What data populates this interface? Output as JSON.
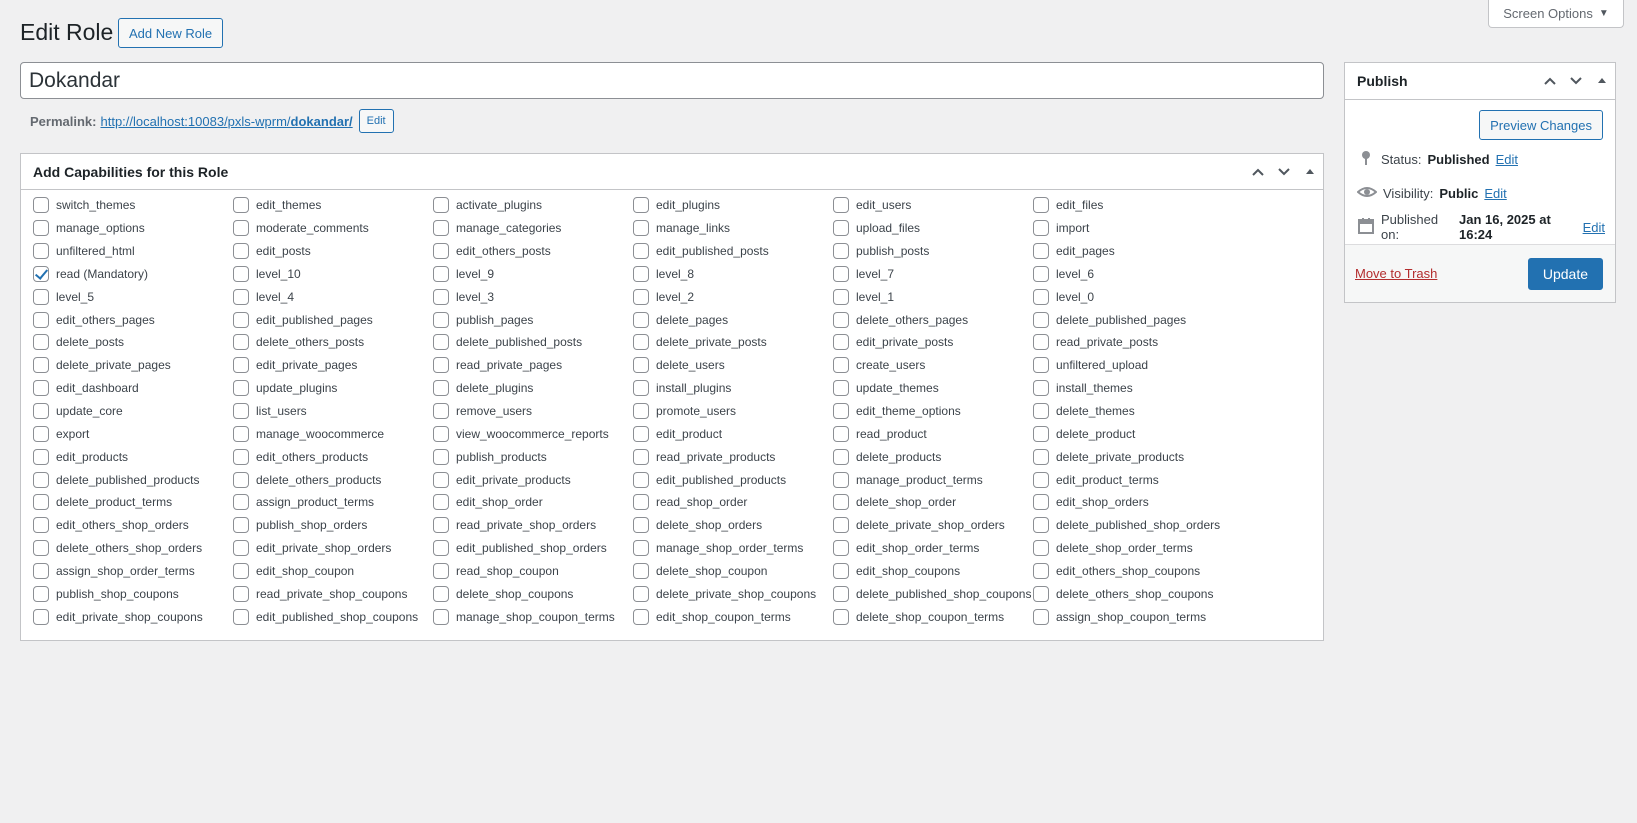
{
  "header": {
    "screen_options": "Screen Options",
    "title": "Edit Role",
    "add_new": "Add New Role"
  },
  "role_name": "Dokandar",
  "permalink": {
    "label": "Permalink:",
    "url_base": "http://localhost:10083/pxls-wprm/",
    "slug": "dokandar/",
    "edit_label": "Edit"
  },
  "capabilities": {
    "title": "Add Capabilities for this Role",
    "items": [
      {
        "label": "switch_themes",
        "checked": false
      },
      {
        "label": "edit_themes",
        "checked": false
      },
      {
        "label": "activate_plugins",
        "checked": false
      },
      {
        "label": "edit_plugins",
        "checked": false
      },
      {
        "label": "edit_users",
        "checked": false
      },
      {
        "label": "edit_files",
        "checked": false
      },
      {
        "label": "manage_options",
        "checked": false
      },
      {
        "label": "moderate_comments",
        "checked": false
      },
      {
        "label": "manage_categories",
        "checked": false
      },
      {
        "label": "manage_links",
        "checked": false
      },
      {
        "label": "upload_files",
        "checked": false
      },
      {
        "label": "import",
        "checked": false
      },
      {
        "label": "unfiltered_html",
        "checked": false
      },
      {
        "label": "edit_posts",
        "checked": false
      },
      {
        "label": "edit_others_posts",
        "checked": false
      },
      {
        "label": "edit_published_posts",
        "checked": false
      },
      {
        "label": "publish_posts",
        "checked": false
      },
      {
        "label": "edit_pages",
        "checked": false
      },
      {
        "label": "read (Mandatory)",
        "checked": true
      },
      {
        "label": "level_10",
        "checked": false
      },
      {
        "label": "level_9",
        "checked": false
      },
      {
        "label": "level_8",
        "checked": false
      },
      {
        "label": "level_7",
        "checked": false
      },
      {
        "label": "level_6",
        "checked": false
      },
      {
        "label": "level_5",
        "checked": false
      },
      {
        "label": "level_4",
        "checked": false
      },
      {
        "label": "level_3",
        "checked": false
      },
      {
        "label": "level_2",
        "checked": false
      },
      {
        "label": "level_1",
        "checked": false
      },
      {
        "label": "level_0",
        "checked": false
      },
      {
        "label": "edit_others_pages",
        "checked": false
      },
      {
        "label": "edit_published_pages",
        "checked": false
      },
      {
        "label": "publish_pages",
        "checked": false
      },
      {
        "label": "delete_pages",
        "checked": false
      },
      {
        "label": "delete_others_pages",
        "checked": false
      },
      {
        "label": "delete_published_pages",
        "checked": false
      },
      {
        "label": "delete_posts",
        "checked": false
      },
      {
        "label": "delete_others_posts",
        "checked": false
      },
      {
        "label": "delete_published_posts",
        "checked": false
      },
      {
        "label": "delete_private_posts",
        "checked": false
      },
      {
        "label": "edit_private_posts",
        "checked": false
      },
      {
        "label": "read_private_posts",
        "checked": false
      },
      {
        "label": "delete_private_pages",
        "checked": false
      },
      {
        "label": "edit_private_pages",
        "checked": false
      },
      {
        "label": "read_private_pages",
        "checked": false
      },
      {
        "label": "delete_users",
        "checked": false
      },
      {
        "label": "create_users",
        "checked": false
      },
      {
        "label": "unfiltered_upload",
        "checked": false
      },
      {
        "label": "edit_dashboard",
        "checked": false
      },
      {
        "label": "update_plugins",
        "checked": false
      },
      {
        "label": "delete_plugins",
        "checked": false
      },
      {
        "label": "install_plugins",
        "checked": false
      },
      {
        "label": "update_themes",
        "checked": false
      },
      {
        "label": "install_themes",
        "checked": false
      },
      {
        "label": "update_core",
        "checked": false
      },
      {
        "label": "list_users",
        "checked": false
      },
      {
        "label": "remove_users",
        "checked": false
      },
      {
        "label": "promote_users",
        "checked": false
      },
      {
        "label": "edit_theme_options",
        "checked": false
      },
      {
        "label": "delete_themes",
        "checked": false
      },
      {
        "label": "export",
        "checked": false
      },
      {
        "label": "manage_woocommerce",
        "checked": false
      },
      {
        "label": "view_woocommerce_reports",
        "checked": false
      },
      {
        "label": "edit_product",
        "checked": false
      },
      {
        "label": "read_product",
        "checked": false
      },
      {
        "label": "delete_product",
        "checked": false
      },
      {
        "label": "edit_products",
        "checked": false
      },
      {
        "label": "edit_others_products",
        "checked": false
      },
      {
        "label": "publish_products",
        "checked": false
      },
      {
        "label": "read_private_products",
        "checked": false
      },
      {
        "label": "delete_products",
        "checked": false
      },
      {
        "label": "delete_private_products",
        "checked": false
      },
      {
        "label": "delete_published_products",
        "checked": false
      },
      {
        "label": "delete_others_products",
        "checked": false
      },
      {
        "label": "edit_private_products",
        "checked": false
      },
      {
        "label": "edit_published_products",
        "checked": false
      },
      {
        "label": "manage_product_terms",
        "checked": false
      },
      {
        "label": "edit_product_terms",
        "checked": false
      },
      {
        "label": "delete_product_terms",
        "checked": false
      },
      {
        "label": "assign_product_terms",
        "checked": false
      },
      {
        "label": "edit_shop_order",
        "checked": false
      },
      {
        "label": "read_shop_order",
        "checked": false
      },
      {
        "label": "delete_shop_order",
        "checked": false
      },
      {
        "label": "edit_shop_orders",
        "checked": false
      },
      {
        "label": "edit_others_shop_orders",
        "checked": false
      },
      {
        "label": "publish_shop_orders",
        "checked": false
      },
      {
        "label": "read_private_shop_orders",
        "checked": false
      },
      {
        "label": "delete_shop_orders",
        "checked": false
      },
      {
        "label": "delete_private_shop_orders",
        "checked": false
      },
      {
        "label": "delete_published_shop_orders",
        "checked": false
      },
      {
        "label": "delete_others_shop_orders",
        "checked": false
      },
      {
        "label": "edit_private_shop_orders",
        "checked": false
      },
      {
        "label": "edit_published_shop_orders",
        "checked": false
      },
      {
        "label": "manage_shop_order_terms",
        "checked": false
      },
      {
        "label": "edit_shop_order_terms",
        "checked": false
      },
      {
        "label": "delete_shop_order_terms",
        "checked": false
      },
      {
        "label": "assign_shop_order_terms",
        "checked": false
      },
      {
        "label": "edit_shop_coupon",
        "checked": false
      },
      {
        "label": "read_shop_coupon",
        "checked": false
      },
      {
        "label": "delete_shop_coupon",
        "checked": false
      },
      {
        "label": "edit_shop_coupons",
        "checked": false
      },
      {
        "label": "edit_others_shop_coupons",
        "checked": false
      },
      {
        "label": "publish_shop_coupons",
        "checked": false
      },
      {
        "label": "read_private_shop_coupons",
        "checked": false
      },
      {
        "label": "delete_shop_coupons",
        "checked": false
      },
      {
        "label": "delete_private_shop_coupons",
        "checked": false
      },
      {
        "label": "delete_published_shop_coupons",
        "checked": false
      },
      {
        "label": "delete_others_shop_coupons",
        "checked": false
      },
      {
        "label": "edit_private_shop_coupons",
        "checked": false
      },
      {
        "label": "edit_published_shop_coupons",
        "checked": false
      },
      {
        "label": "manage_shop_coupon_terms",
        "checked": false
      },
      {
        "label": "edit_shop_coupon_terms",
        "checked": false
      },
      {
        "label": "delete_shop_coupon_terms",
        "checked": false
      },
      {
        "label": "assign_shop_coupon_terms",
        "checked": false
      }
    ]
  },
  "publish": {
    "title": "Publish",
    "preview": "Preview Changes",
    "status_label": "Status:",
    "status_value": "Published",
    "visibility_label": "Visibility:",
    "visibility_value": "Public",
    "published_label": "Published on:",
    "published_value": "Jan 16, 2025 at 16:24",
    "edit_link": "Edit",
    "trash": "Move to Trash",
    "update": "Update"
  },
  "colors": {
    "accent": "#2271b1",
    "danger": "#b32d2e",
    "background": "#f0f0f1"
  }
}
